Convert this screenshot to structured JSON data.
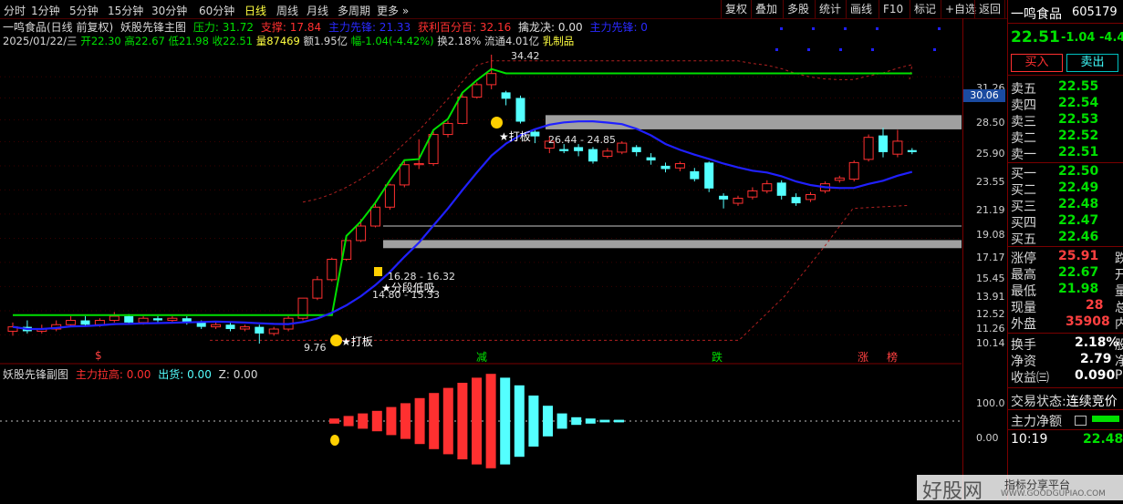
{
  "topbar": {
    "periods": [
      "分时",
      "1分钟",
      "5分钟",
      "15分钟",
      "30分钟",
      "60分钟",
      "日线",
      "周线",
      "月线",
      "多周期",
      "更多 »"
    ],
    "active_period": "日线",
    "right_buttons": [
      "复权",
      "叠加",
      "多股",
      "统计",
      "画线",
      "F10",
      "标记",
      "+自选",
      "返回"
    ]
  },
  "chart_header": {
    "stock_title": "一鸣食品(日线 前复权)",
    "indicator_name": "妖股先锋主图",
    "pressure_label": "压力: 31.72",
    "support_label": "支撑: 17.84",
    "extra_label1": "主力先锋: 21.33",
    "profit_label": "获利百分百: 32.16",
    "dragon_label": "擒龙决: 0.00",
    "extra_label2": "主力先锋: 0"
  },
  "info_line": {
    "date": "2025/01/22/三",
    "open": "开22.30",
    "high": "高22.67",
    "low": "低21.98",
    "close": "收22.51",
    "volume": "量87469",
    "amount": "额1.95亿",
    "change": "幅-1.04(-4.42%)",
    "turnover": "换2.18%",
    "float_cap": "流通4.01亿",
    "sector": "乳制品"
  },
  "annotations": {
    "high_price": "34.42",
    "low_price": "9.76",
    "zone_upper": "26.44 - 24.85",
    "zone_lower1": "16.28 - 16.32",
    "zone_lower2": "14.80 - 15.33",
    "tag_limit1": "★打板",
    "tag_limit2": "★打板",
    "tag_bottom": "★分段低吸",
    "marker_jian": "减",
    "marker_die": "跌",
    "marker_zhang": "涨",
    "marker_bang": "榜",
    "marker_dollar": "$"
  },
  "price_axis": {
    "ticks": [
      "31.26",
      "28.50",
      "25.90",
      "23.55",
      "21.19",
      "19.08",
      "17.17",
      "15.45",
      "13.91",
      "12.52",
      "11.26",
      "10.14"
    ],
    "current_tag": "30.06",
    "sub_ticks": [
      "100.0",
      "0.00"
    ]
  },
  "sub_chart": {
    "title": "妖股先锋副图",
    "main_raise": "主力拉高: 0.00",
    "shipment": "出货: 0.00",
    "z": "Z: 0.00",
    "bars": [
      2,
      4,
      6,
      8,
      11,
      14,
      18,
      22,
      26,
      30,
      34,
      37,
      -34,
      -28,
      -20,
      -12,
      -6,
      -3,
      -2,
      -1,
      -1
    ]
  },
  "candles": [
    {
      "o": 10.3,
      "c": 10.5,
      "h": 10.7,
      "l": 10.1
    },
    {
      "o": 10.5,
      "c": 10.3,
      "h": 10.8,
      "l": 10.2
    },
    {
      "o": 10.3,
      "c": 10.4,
      "h": 10.6,
      "l": 10.2
    },
    {
      "o": 10.4,
      "c": 10.6,
      "h": 10.8,
      "l": 10.3
    },
    {
      "o": 10.6,
      "c": 10.8,
      "h": 11.0,
      "l": 10.5
    },
    {
      "o": 10.8,
      "c": 10.6,
      "h": 11.0,
      "l": 10.5
    },
    {
      "o": 10.6,
      "c": 10.8,
      "h": 10.9,
      "l": 10.5
    },
    {
      "o": 10.8,
      "c": 11.0,
      "h": 11.2,
      "l": 10.7
    },
    {
      "o": 11.0,
      "c": 10.7,
      "h": 11.1,
      "l": 10.6
    },
    {
      "o": 10.7,
      "c": 10.9,
      "h": 11.0,
      "l": 10.6
    },
    {
      "o": 10.9,
      "c": 10.8,
      "h": 11.0,
      "l": 10.7
    },
    {
      "o": 10.8,
      "c": 10.9,
      "h": 11.0,
      "l": 10.7
    },
    {
      "o": 10.9,
      "c": 10.7,
      "h": 11.0,
      "l": 10.6
    },
    {
      "o": 10.7,
      "c": 10.5,
      "h": 10.8,
      "l": 10.4
    },
    {
      "o": 10.5,
      "c": 10.6,
      "h": 10.7,
      "l": 10.4
    },
    {
      "o": 10.6,
      "c": 10.4,
      "h": 10.7,
      "l": 10.3
    },
    {
      "o": 10.4,
      "c": 10.5,
      "h": 10.6,
      "l": 10.3
    },
    {
      "o": 10.5,
      "c": 10.2,
      "h": 10.6,
      "l": 9.76
    },
    {
      "o": 10.2,
      "c": 10.4,
      "h": 10.5,
      "l": 10.1
    },
    {
      "o": 10.4,
      "c": 10.9,
      "h": 11.0,
      "l": 10.3
    },
    {
      "o": 10.9,
      "c": 11.9,
      "h": 11.9,
      "l": 10.8
    },
    {
      "o": 11.9,
      "c": 12.9,
      "h": 13.1,
      "l": 11.8
    },
    {
      "o": 12.9,
      "c": 14.1,
      "h": 14.2,
      "l": 12.8
    },
    {
      "o": 14.1,
      "c": 15.3,
      "h": 15.6,
      "l": 14.0
    },
    {
      "o": 15.3,
      "c": 16.3,
      "h": 16.8,
      "l": 15.2
    },
    {
      "o": 16.3,
      "c": 17.7,
      "h": 18.0,
      "l": 16.2
    },
    {
      "o": 17.7,
      "c": 19.5,
      "h": 19.6,
      "l": 17.5
    },
    {
      "o": 19.5,
      "c": 21.3,
      "h": 21.6,
      "l": 19.3
    },
    {
      "o": 21.3,
      "c": 21.4,
      "h": 23.8,
      "l": 20.9
    },
    {
      "o": 21.4,
      "c": 24.3,
      "h": 24.6,
      "l": 21.2
    },
    {
      "o": 24.3,
      "c": 25.5,
      "h": 25.8,
      "l": 24.0
    },
    {
      "o": 25.5,
      "c": 28.6,
      "h": 29.2,
      "l": 25.4
    },
    {
      "o": 28.6,
      "c": 30.2,
      "h": 30.5,
      "l": 28.4
    },
    {
      "o": 30.2,
      "c": 31.7,
      "h": 34.42,
      "l": 29.6
    },
    {
      "o": 29.2,
      "c": 28.4,
      "h": 29.4,
      "l": 27.6
    },
    {
      "o": 28.5,
      "c": 25.7,
      "h": 28.8,
      "l": 25.5
    },
    {
      "o": 24.6,
      "c": 24.1,
      "h": 24.9,
      "l": 23.4
    },
    {
      "o": 22.9,
      "c": 23.6,
      "h": 24.1,
      "l": 22.4
    },
    {
      "o": 22.8,
      "c": 22.6,
      "h": 23.3,
      "l": 22.4
    },
    {
      "o": 23.0,
      "c": 22.6,
      "h": 23.3,
      "l": 22.1
    },
    {
      "o": 22.8,
      "c": 21.6,
      "h": 23.0,
      "l": 21.4
    },
    {
      "o": 22.1,
      "c": 22.6,
      "h": 22.9,
      "l": 21.9
    },
    {
      "o": 22.5,
      "c": 23.4,
      "h": 23.6,
      "l": 22.3
    },
    {
      "o": 23.0,
      "c": 22.5,
      "h": 23.2,
      "l": 22.1
    },
    {
      "o": 22.0,
      "c": 21.7,
      "h": 22.4,
      "l": 21.3
    },
    {
      "o": 21.2,
      "c": 20.9,
      "h": 21.5,
      "l": 20.6
    },
    {
      "o": 21.0,
      "c": 21.4,
      "h": 21.6,
      "l": 20.7
    },
    {
      "o": 20.7,
      "c": 20.0,
      "h": 21.0,
      "l": 19.8
    },
    {
      "o": 21.5,
      "c": 19.2,
      "h": 21.6,
      "l": 18.9
    },
    {
      "o": 18.6,
      "c": 18.3,
      "h": 18.8,
      "l": 17.6
    },
    {
      "o": 18.0,
      "c": 18.4,
      "h": 18.6,
      "l": 17.8
    },
    {
      "o": 18.5,
      "c": 19.0,
      "h": 19.3,
      "l": 18.3
    },
    {
      "o": 19.0,
      "c": 19.6,
      "h": 19.9,
      "l": 18.8
    },
    {
      "o": 19.7,
      "c": 18.6,
      "h": 19.9,
      "l": 18.3
    },
    {
      "o": 18.5,
      "c": 18.0,
      "h": 18.8,
      "l": 17.8
    },
    {
      "o": 18.3,
      "c": 18.7,
      "h": 18.9,
      "l": 18.1
    },
    {
      "o": 19.0,
      "c": 19.6,
      "h": 19.8,
      "l": 18.8
    },
    {
      "o": 19.9,
      "c": 20.1,
      "h": 20.3,
      "l": 19.7
    },
    {
      "o": 20.0,
      "c": 21.5,
      "h": 21.7,
      "l": 19.8
    },
    {
      "o": 21.8,
      "c": 24.0,
      "h": 24.3,
      "l": 21.6
    },
    {
      "o": 24.2,
      "c": 22.5,
      "h": 25.0,
      "l": 22.0
    },
    {
      "o": 22.3,
      "c": 23.6,
      "h": 24.8,
      "l": 22.0
    },
    {
      "o": 22.7,
      "c": 22.5,
      "h": 22.9,
      "l": 22.3
    }
  ],
  "quote": {
    "name": "一鸣食品",
    "code": "605179",
    "price": "22.51",
    "change": "-1.04",
    "pct": "-4.4",
    "buy_button": "买入",
    "sell_button": "卖出",
    "sells": [
      {
        "label": "卖五",
        "price": "22.55"
      },
      {
        "label": "卖四",
        "price": "22.54"
      },
      {
        "label": "卖三",
        "price": "22.53"
      },
      {
        "label": "卖二",
        "price": "22.52"
      },
      {
        "label": "卖一",
        "price": "22.51"
      }
    ],
    "buys": [
      {
        "label": "买一",
        "price": "22.50"
      },
      {
        "label": "买二",
        "price": "22.49"
      },
      {
        "label": "买三",
        "price": "22.48"
      },
      {
        "label": "买四",
        "price": "22.47"
      },
      {
        "label": "买五",
        "price": "22.46"
      }
    ],
    "stats": [
      {
        "label": "涨停",
        "value": "25.91",
        "suffix": "跌"
      },
      {
        "label": "最高",
        "value": "22.67",
        "suffix": "开"
      },
      {
        "label": "最低",
        "value": "21.98",
        "suffix": "量"
      },
      {
        "label": "现量",
        "value": "28",
        "suffix": "总"
      },
      {
        "label": "外盘",
        "value": "35908",
        "suffix": "内"
      }
    ],
    "stats2": [
      {
        "label": "换手",
        "value": "2.18%",
        "suffix": "股"
      },
      {
        "label": "净资",
        "value": "2.79",
        "suffix": "净"
      },
      {
        "label": "收益㈢",
        "value": "0.090",
        "suffix": "P"
      }
    ],
    "trade_status_label": "交易状态:",
    "trade_status_value": "连续竞价",
    "main_net_label": "主力净额",
    "time": "10:19",
    "last_price": "22.48"
  },
  "watermark": {
    "big": "好股网",
    "small1": "指标分享平台",
    "small2": "WWW.GOODGUPIAO.COM"
  },
  "colors": {
    "up": "#ff3030",
    "down": "#54ffff",
    "ma_green": "#00e000",
    "ma_blue": "#2020ff",
    "zone": "#a0a0a0"
  }
}
